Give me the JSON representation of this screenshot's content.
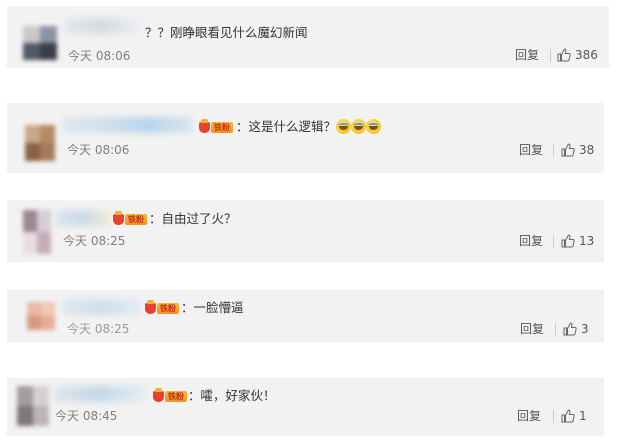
{
  "comments": [
    {
      "text": "？？刚睁眼看见什么魔幻新闻",
      "time": "今天 08:06",
      "reply_label": "回复",
      "likes": "386",
      "has_fan_badge": false
    },
    {
      "text": "：这是什么逻辑？",
      "emoji_count": 3,
      "time": "今天 08:06",
      "reply_label": "回复",
      "likes": "38",
      "has_fan_badge": true
    },
    {
      "text": "：自由过了火？",
      "time": "今天 08:25",
      "reply_label": "回复",
      "likes": "13",
      "has_fan_badge": true
    },
    {
      "text": "：一脸懵逼",
      "time": "今天 08:25",
      "reply_label": "回复",
      "likes": "3",
      "has_fan_badge": true
    },
    {
      "text": "：嚯，好家伙！",
      "time": "今天 08:45",
      "reply_label": "回复",
      "likes": "1",
      "has_fan_badge": true
    }
  ],
  "fan_badge_label": "铁粉",
  "icons": {
    "like": "thumbs-up-icon",
    "emoji": "laughing-tears-emoji-icon",
    "fan_badge": "fan-badge-icon"
  },
  "colors": {
    "card_bg": "#f2f2f2",
    "text": "#333333",
    "meta": "#808080",
    "badge_orange": "#f39322",
    "badge_red": "#e8412c"
  }
}
